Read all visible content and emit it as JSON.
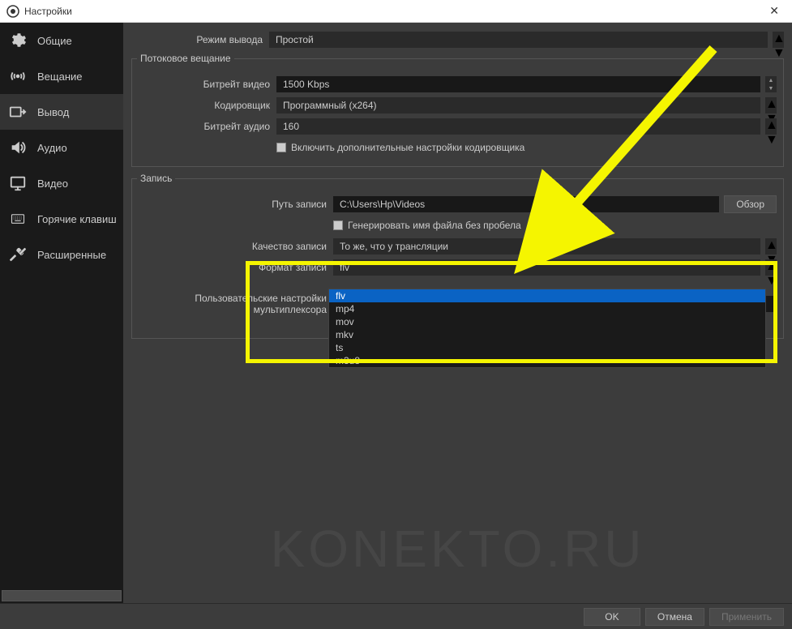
{
  "window": {
    "title": "Настройки"
  },
  "sidebar": {
    "items": [
      {
        "label": "Общие"
      },
      {
        "label": "Вещание"
      },
      {
        "label": "Вывод"
      },
      {
        "label": "Аудио"
      },
      {
        "label": "Видео"
      },
      {
        "label": "Горячие клавиш"
      },
      {
        "label": "Расширенные"
      }
    ]
  },
  "output_mode": {
    "label": "Режим вывода",
    "value": "Простой"
  },
  "streaming": {
    "title": "Потоковое вещание",
    "video_bitrate": {
      "label": "Битрейт видео",
      "value": "1500 Kbps"
    },
    "encoder": {
      "label": "Кодировщик",
      "value": "Программный (x264)"
    },
    "audio_bitrate": {
      "label": "Битрейт аудио",
      "value": "160"
    },
    "advanced_checkbox": "Включить дополнительные настройки кодировщика"
  },
  "recording": {
    "title": "Запись",
    "path": {
      "label": "Путь записи",
      "value": "C:\\Users\\Hp\\Videos",
      "browse": "Обзор"
    },
    "no_space_checkbox": "Генерировать имя файла без пробела",
    "quality": {
      "label": "Качество записи",
      "value": "То же, что у трансляции"
    },
    "format": {
      "label": "Формат записи",
      "value": "flv",
      "options": [
        "flv",
        "mp4",
        "mov",
        "mkv",
        "ts",
        "m3u8"
      ]
    },
    "mux": {
      "label": "Пользовательские настройки мультиплексора"
    }
  },
  "footer": {
    "ok": "OK",
    "cancel": "Отмена",
    "apply": "Применить"
  },
  "watermark": "KONEKTO.RU"
}
